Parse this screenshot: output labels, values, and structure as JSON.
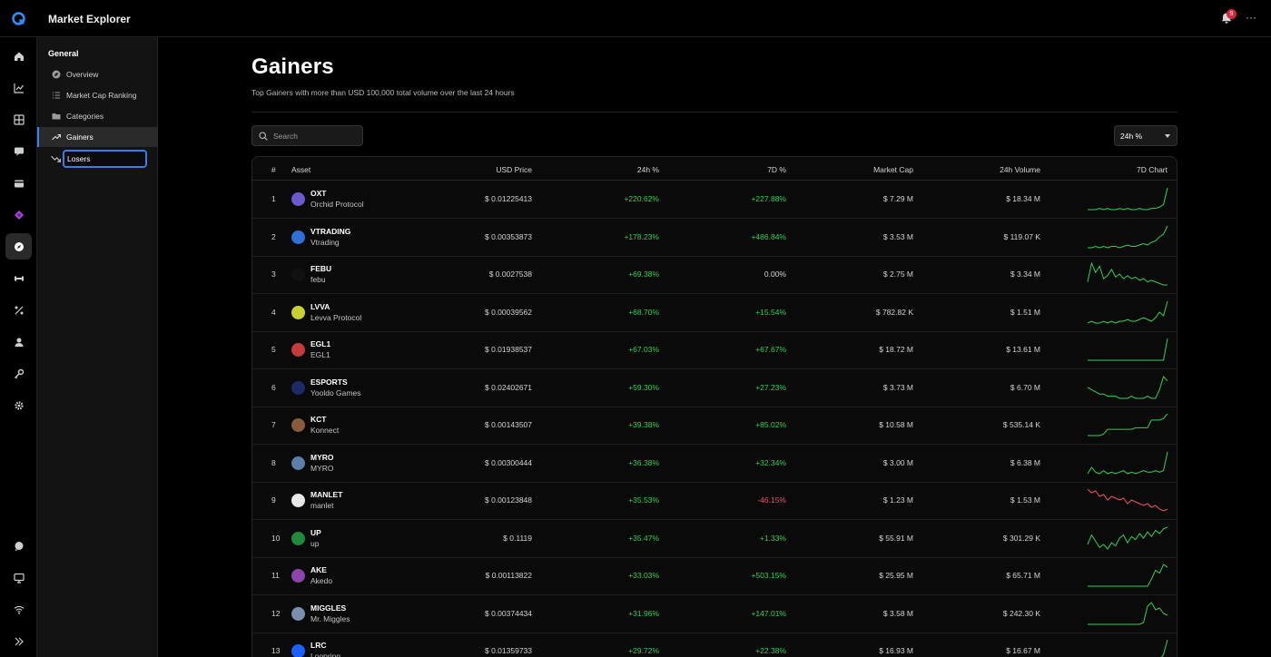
{
  "app": {
    "title": "Market Explorer",
    "notification_count": "9",
    "more_label": "···"
  },
  "sidebar": {
    "heading": "General",
    "items": [
      {
        "label": "Overview",
        "icon": "compass-icon"
      },
      {
        "label": "Market Cap Ranking",
        "icon": "list-icon"
      },
      {
        "label": "Categories",
        "icon": "folder-icon"
      },
      {
        "label": "Gainers",
        "icon": "trending-up-icon"
      },
      {
        "label": "Losers",
        "icon": "trending-down-icon"
      }
    ]
  },
  "page": {
    "title": "Gainers",
    "subtitle": "Top Gainers with more than USD 100,000 total volume over the last 24 hours"
  },
  "search": {
    "placeholder": "Search"
  },
  "filter": {
    "selected": "24h %"
  },
  "table": {
    "columns": [
      "#",
      "Asset",
      "USD Price",
      "24h %",
      "7D %",
      "Market Cap",
      "24h Volume",
      "7D Chart"
    ],
    "rows": [
      {
        "rank": "1",
        "symbol": "OXT",
        "name": "Orchid Protocol",
        "price": "$ 0.01225413",
        "change_24h": "+220.62%",
        "change_7d": "+227.88%",
        "market_cap": "$ 7.29 M",
        "volume": "$ 18.34 M",
        "trend": "up",
        "coin_color": "#6a5acd"
      },
      {
        "rank": "2",
        "symbol": "VTRADING",
        "name": "Vtrading",
        "price": "$ 0.00353873",
        "change_24h": "+178.23%",
        "change_7d": "+486.84%",
        "market_cap": "$ 3.53 M",
        "volume": "$ 119.07 K",
        "trend": "up",
        "coin_color": "#2f6fd6"
      },
      {
        "rank": "3",
        "symbol": "FEBU",
        "name": "febu",
        "price": "$ 0.0027538",
        "change_24h": "+69.38%",
        "change_7d": "0.00%",
        "market_cap": "$ 2.75 M",
        "volume": "$ 3.34 M",
        "trend": "up",
        "coin_color": "#111111"
      },
      {
        "rank": "4",
        "symbol": "LVVA",
        "name": "Levva Protocol",
        "price": "$ 0.00039562",
        "change_24h": "+68.70%",
        "change_7d": "+15.54%",
        "market_cap": "$ 782.82 K",
        "volume": "$ 1.51 M",
        "trend": "up",
        "coin_color": "#c8d12f"
      },
      {
        "rank": "5",
        "symbol": "EGL1",
        "name": "EGL1",
        "price": "$ 0.01938537",
        "change_24h": "+67.03%",
        "change_7d": "+67.67%",
        "market_cap": "$ 18.72 M",
        "volume": "$ 13.61 M",
        "trend": "up",
        "coin_color": "#c43b3b"
      },
      {
        "rank": "6",
        "symbol": "ESPORTS",
        "name": "Yooldo Games",
        "price": "$ 0.02402671",
        "change_24h": "+59.30%",
        "change_7d": "+27.23%",
        "market_cap": "$ 3.73 M",
        "volume": "$ 6.70 M",
        "trend": "up",
        "coin_color": "#1c2a66"
      },
      {
        "rank": "7",
        "symbol": "KCT",
        "name": "Konnect",
        "price": "$ 0.00143507",
        "change_24h": "+39.38%",
        "change_7d": "+85.02%",
        "market_cap": "$ 10.58 M",
        "volume": "$ 535.14 K",
        "trend": "up",
        "coin_color": "#8a5a3c"
      },
      {
        "rank": "8",
        "symbol": "MYRO",
        "name": "MYRO",
        "price": "$ 0.00300444",
        "change_24h": "+36.38%",
        "change_7d": "+32.34%",
        "market_cap": "$ 3.00 M",
        "volume": "$ 6.38 M",
        "trend": "up",
        "coin_color": "#5b7fa8"
      },
      {
        "rank": "9",
        "symbol": "MANLET",
        "name": "manlet",
        "price": "$ 0.00123848",
        "change_24h": "+35.53%",
        "change_7d": "-46.15%",
        "market_cap": "$ 1.23 M",
        "volume": "$ 1.53 M",
        "trend": "down",
        "coin_color": "#e8e8e8"
      },
      {
        "rank": "10",
        "symbol": "UP",
        "name": "up",
        "price": "$ 0.1119",
        "change_24h": "+35.47%",
        "change_7d": "+1.33%",
        "market_cap": "$ 55.91 M",
        "volume": "$ 301.29 K",
        "trend": "up",
        "coin_color": "#1f8a3c"
      },
      {
        "rank": "11",
        "symbol": "AKE",
        "name": "Akedo",
        "price": "$ 0.00113822",
        "change_24h": "+33.03%",
        "change_7d": "+503.15%",
        "market_cap": "$ 25.95 M",
        "volume": "$ 65.71 M",
        "trend": "up",
        "coin_color": "#8e44ad"
      },
      {
        "rank": "12",
        "symbol": "MIGGLES",
        "name": "Mr. Miggles",
        "price": "$ 0.00374434",
        "change_24h": "+31.96%",
        "change_7d": "+147.01%",
        "market_cap": "$ 3.58 M",
        "volume": "$ 242.30 K",
        "trend": "up",
        "coin_color": "#7a8fb0"
      },
      {
        "rank": "13",
        "symbol": "LRC",
        "name": "Loopring",
        "price": "$ 0.01359733",
        "change_24h": "+29.72%",
        "change_7d": "+22.38%",
        "market_cap": "$ 16.93 M",
        "volume": "$ 16.67 M",
        "trend": "up",
        "coin_color": "#1c60ff"
      }
    ]
  },
  "colors": {
    "positive": "#31d158",
    "negative": "#f0506e",
    "accent": "#3b82f6",
    "badge": "#d8263a"
  }
}
